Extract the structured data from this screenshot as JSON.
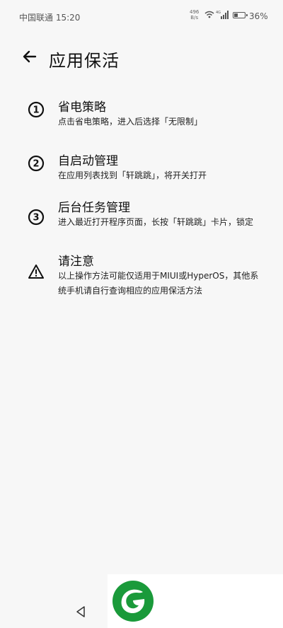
{
  "status_bar": {
    "carrier_time": "中国联通 15:20",
    "net_speed_value": "496",
    "net_speed_unit": "B/s",
    "battery_level": 0.36,
    "battery_text": "36%"
  },
  "header": {
    "title": "应用保活"
  },
  "items": [
    {
      "title": "省电策略",
      "desc": "点击省电策略，进入后选择「无限制」"
    },
    {
      "title": "自启动管理",
      "desc": "在应用列表找到「轩跳跳」，将开关打开"
    },
    {
      "title": "后台任务管理",
      "desc": "进入最近打开程序页面，长按「轩跳跳」卡片，锁定"
    },
    {
      "title": "请注意",
      "desc": "以上操作方法可能仅适用于MIUI或HyperOS，其他系统手机请自行查询相应的应用保活方法"
    }
  ],
  "colors": {
    "logo_green": "#1a9a3a"
  }
}
